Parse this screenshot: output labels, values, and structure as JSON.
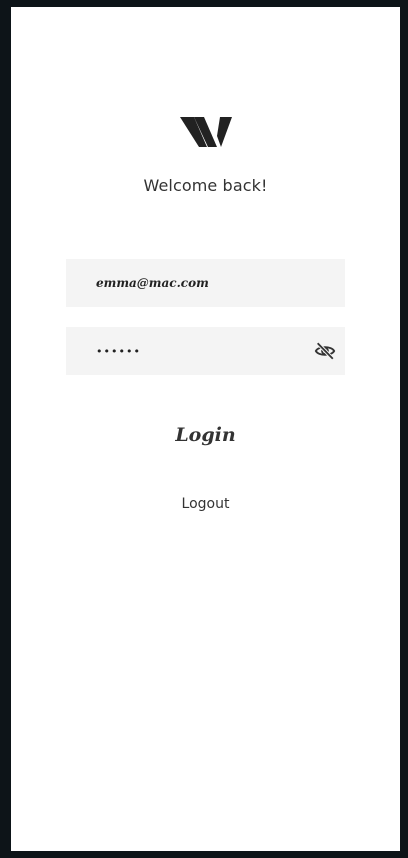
{
  "logo": {
    "icon": "w-monogram-logo"
  },
  "welcome_text": "Welcome back!",
  "email_field": {
    "value": "emma@mac.com"
  },
  "password_field": {
    "value": "••••••",
    "toggle_icon": "eye-slash-icon"
  },
  "login_label": "Login",
  "logout_label": "Logout",
  "colors": {
    "background": "#0d1418",
    "card": "#ffffff",
    "field": "#f4f4f4",
    "text": "#333333"
  }
}
